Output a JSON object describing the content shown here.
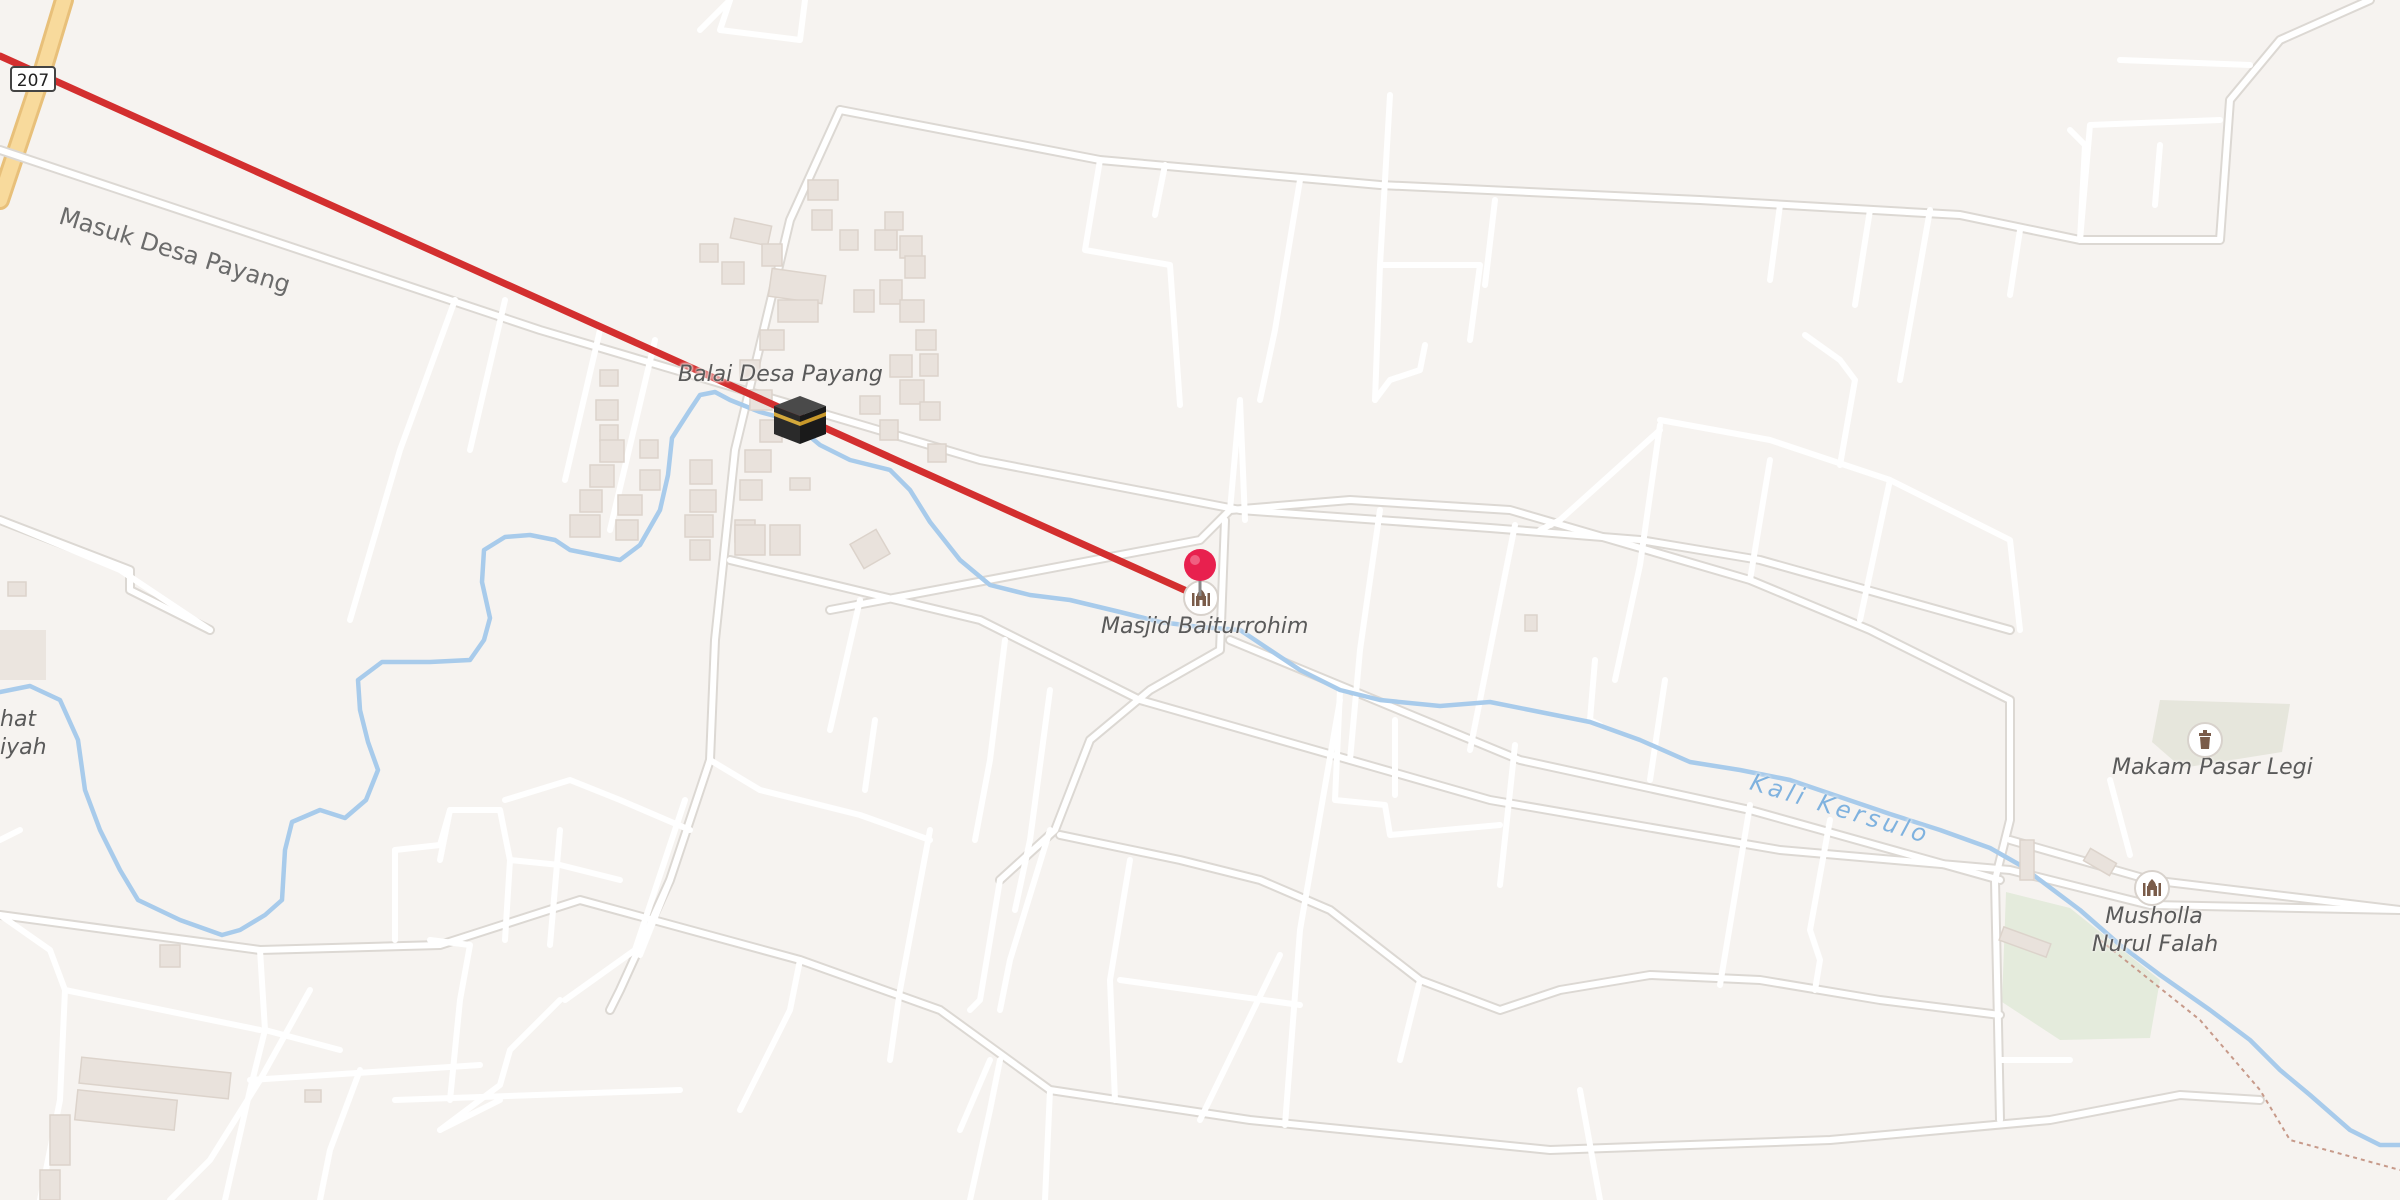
{
  "map": {
    "route_shield": "207",
    "road_labels": {
      "masuk_desa_payang": "Masuk Desa Payang"
    },
    "water_labels": {
      "kali_kersulo": "Kali Kersulo"
    },
    "places": {
      "balai_desa_payang": "Balai Desa Payang",
      "masjid_baiturrohim": "Masjid Baiturrohim",
      "makam_pasar_legi": "Makam Pasar Legi",
      "musholla_line1": "Musholla",
      "musholla_line2": "Nurul Falah",
      "partial_line1": "hat",
      "partial_line2": "iyah"
    },
    "icons": {
      "kaaba_marker": "kaaba-icon",
      "destination_pin": "location-pin-icon",
      "mosque": "mosque-icon",
      "cemetery": "grave-icon"
    },
    "colors": {
      "background": "#f6f3f0",
      "road": "#ffffff",
      "river": "#a8cbeb",
      "qibla_line": "#d32f2f",
      "pin": "#e8204e",
      "major_road": "#f6d08a"
    }
  }
}
